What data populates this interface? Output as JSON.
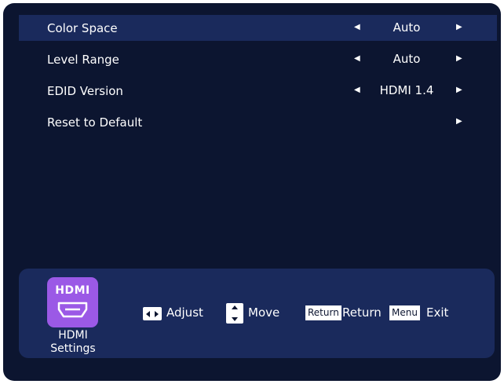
{
  "menu": {
    "items": [
      {
        "label": "Color Space",
        "value": "Auto"
      },
      {
        "label": "Level Range",
        "value": "Auto"
      },
      {
        "label": "EDID Version",
        "value": "HDMI 1.4"
      },
      {
        "label": "Reset to Default",
        "value": ""
      }
    ]
  },
  "footer": {
    "source_icon_text": "HDMI",
    "source_label": "HDMI Settings",
    "hints": {
      "adjust": "Adjust",
      "move": "Move",
      "return_key": "Return",
      "return_label": "Return",
      "menu_key": "Menu",
      "exit_label": "Exit"
    }
  },
  "colors": {
    "background": "#0c1530",
    "selected_row": "#1a2a5c",
    "footer_bar": "#1a2a5c",
    "hdmi_icon": "#9b59e6",
    "text": "#ffffff"
  }
}
